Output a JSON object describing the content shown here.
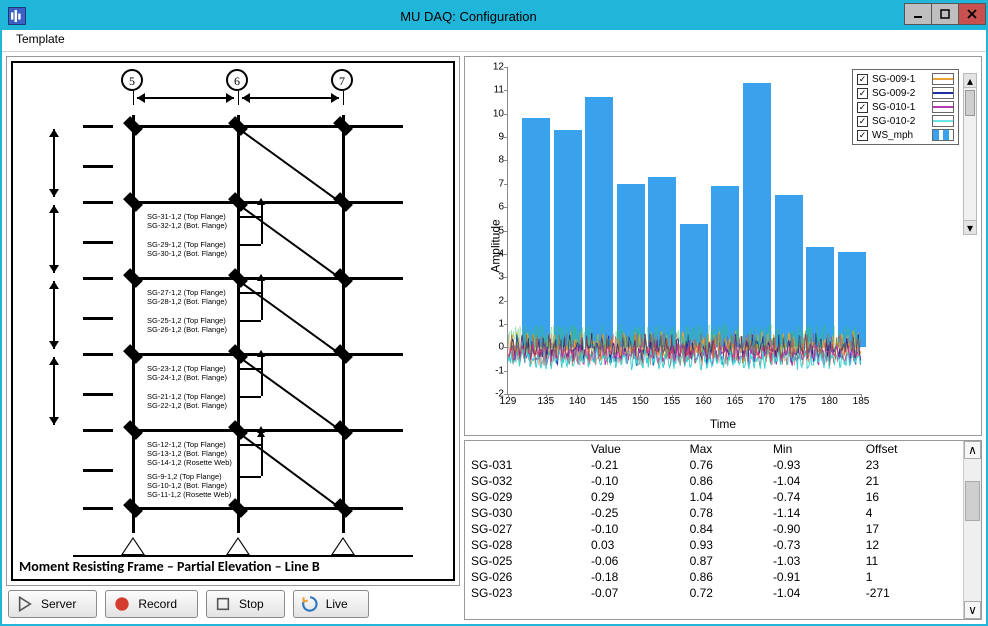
{
  "window": {
    "title": "MU DAQ: Configuration"
  },
  "menu": {
    "template": "Template"
  },
  "diagram": {
    "caption": "Moment Resisting Frame – Partial Elevation – Line B",
    "grid_labels": [
      "5",
      "6",
      "7"
    ],
    "sensor_labels": [
      "SG-31-1,2 (Top Flange)",
      "SG-32-1,2 (Bot. Flange)",
      "SG-29-1,2 (Top Flange)",
      "SG-30-1,2 (Bot. Flange)",
      "SG-27-1,2 (Top Flange)",
      "SG-28-1,2 (Bot. Flange)",
      "SG-25-1,2 (Top Flange)",
      "SG-26-1,2 (Bot. Flange)",
      "SG-23-1,2 (Top Flange)",
      "SG-24-1,2 (Bot. Flange)",
      "SG-21-1,2 (Top Flange)",
      "SG-22-1,2 (Bot. Flange)",
      "SG-12-1,2 (Top Flange)",
      "SG-13-1,2 (Bot. Flange)",
      "SG-14-1,2 (Rosette Web)",
      "SG-9-1,2 (Top Flange)",
      "SG-10-1,2 (Bot. Flange)",
      "SG-11-1,2 (Rosette Web)"
    ]
  },
  "buttons": {
    "server": "Server",
    "record": "Record",
    "stop": "Stop",
    "live": "Live"
  },
  "chart_data": {
    "type": "bar+line",
    "title": "",
    "xlabel": "Time",
    "ylabel": "Amplitude",
    "xlim": [
      129,
      185
    ],
    "ylim": [
      -2,
      12
    ],
    "xticks": [
      129,
      135,
      140,
      145,
      150,
      155,
      160,
      165,
      170,
      175,
      180,
      185
    ],
    "yticks": [
      -2,
      -1,
      0,
      1,
      2,
      3,
      4,
      5,
      6,
      7,
      8,
      9,
      10,
      11,
      12
    ],
    "bar_series": {
      "name": "WS_mph",
      "x": [
        133.5,
        138.5,
        143.5,
        148.5,
        153.5,
        158.5,
        163.5,
        168.5,
        173.5,
        178.5,
        183.5
      ],
      "values": [
        9.8,
        9.3,
        10.7,
        7.0,
        7.3,
        5.3,
        6.9,
        11.3,
        6.5,
        4.3,
        4.1
      ]
    },
    "noise_series": [
      {
        "name": "SG-009-1",
        "color": "#e8a23a",
        "mean": 0.0,
        "amp": 0.9
      },
      {
        "name": "SG-009-2",
        "color": "#1e2f9e",
        "mean": -0.1,
        "amp": 0.9
      },
      {
        "name": "SG-010-1",
        "color": "#b23ab2",
        "mean": -0.3,
        "amp": 0.6
      },
      {
        "name": "SG-010-2",
        "color": "#3ad1d1",
        "mean": -0.5,
        "amp": 0.6
      }
    ],
    "legend": [
      "SG-009-1",
      "SG-009-2",
      "SG-010-1",
      "SG-010-2",
      "WS_mph"
    ],
    "legend_colors": [
      "#e8a23a",
      "#1e2f9e",
      "#b23ab2",
      "#6fe3e3",
      "#3aa2ec"
    ]
  },
  "table": {
    "headers": [
      "",
      "Value",
      "Max",
      "Min",
      "Offset"
    ],
    "rows": [
      {
        "name": "SG-031",
        "value": "-0.21",
        "max": "0.76",
        "min": "-0.93",
        "offset": "23"
      },
      {
        "name": "SG-032",
        "value": "-0.10",
        "max": "0.86",
        "min": "-1.04",
        "offset": "21"
      },
      {
        "name": "SG-029",
        "value": "0.29",
        "max": "1.04",
        "min": "-0.74",
        "offset": "16"
      },
      {
        "name": "SG-030",
        "value": "-0.25",
        "max": "0.78",
        "min": "-1.14",
        "offset": "4"
      },
      {
        "name": "SG-027",
        "value": "-0.10",
        "max": "0.84",
        "min": "-0.90",
        "offset": "17"
      },
      {
        "name": "SG-028",
        "value": "0.03",
        "max": "0.93",
        "min": "-0.73",
        "offset": "12"
      },
      {
        "name": "SG-025",
        "value": "-0.06",
        "max": "0.87",
        "min": "-1.03",
        "offset": "11"
      },
      {
        "name": "SG-026",
        "value": "-0.18",
        "max": "0.86",
        "min": "-0.91",
        "offset": "1"
      },
      {
        "name": "SG-023",
        "value": "-0.07",
        "max": "0.72",
        "min": "-1.04",
        "offset": "-271"
      }
    ]
  }
}
